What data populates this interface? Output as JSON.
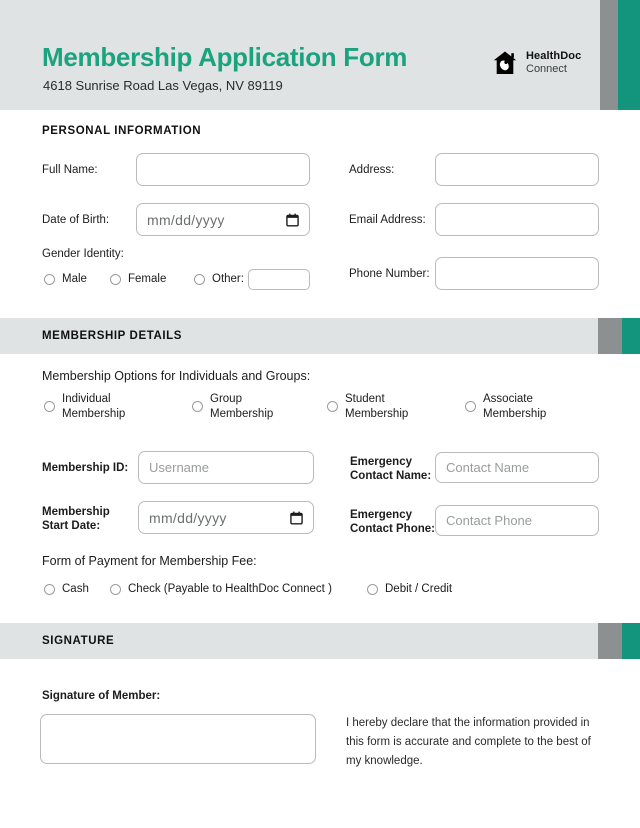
{
  "header": {
    "title": "Membership Application Form",
    "address": "4618 Sunrise Road Las Vegas, NV 89119",
    "brand_name": "HealthDoc",
    "brand_sub": "Connect",
    "title_color": "#1ba37f",
    "accent_teal": "#12957c",
    "accent_gray": "#8c9090",
    "band_bg": "#dfe3e3"
  },
  "personal_information": {
    "section_title": "PERSONAL INFORMATION",
    "full_name_label": "Full Name:",
    "full_name_value": "",
    "date_of_birth_label": "Date of Birth:",
    "date_of_birth_placeholder": "mm/dd/yyyy",
    "gender_identity_label": "Gender Identity:",
    "gender_options": [
      "Male",
      "Female",
      "Other:"
    ],
    "gender_other_value": "",
    "address_label": "Address:",
    "address_value": "",
    "email_label": "Email Address:",
    "email_value": "",
    "phone_label": "Phone Number:",
    "phone_value": ""
  },
  "membership_details": {
    "section_title": "MEMBERSHIP DETAILS",
    "options_heading": "Membership Options for Individuals and Groups:",
    "options": [
      "Individual\nMembership",
      "Group\nMembership",
      "Student\nMembership",
      "Associate\nMembership"
    ],
    "membership_id_label": "Membership ID:",
    "membership_id_placeholder": "Username",
    "membership_id_value": "",
    "start_date_label": "Membership\nStart Date:",
    "start_date_placeholder": "mm/dd/yyyy",
    "emergency_name_label": "Emergency\nContact Name:",
    "emergency_name_placeholder": "Contact Name",
    "emergency_name_value": "",
    "emergency_phone_label": "Emergency\nContact Phone:",
    "emergency_phone_placeholder": "Contact Phone",
    "emergency_phone_value": "",
    "payment_heading": "Form of Payment for Membership Fee:",
    "payment_options": [
      "Cash",
      "Check (Payable to HealthDoc Connect )",
      "Debit / Credit"
    ]
  },
  "signature": {
    "section_title": "SIGNATURE",
    "signature_label": "Signature of Member:",
    "signature_value": "",
    "declaration": "I hereby declare that the information provided in this form is accurate and complete to the best of my knowledge."
  }
}
